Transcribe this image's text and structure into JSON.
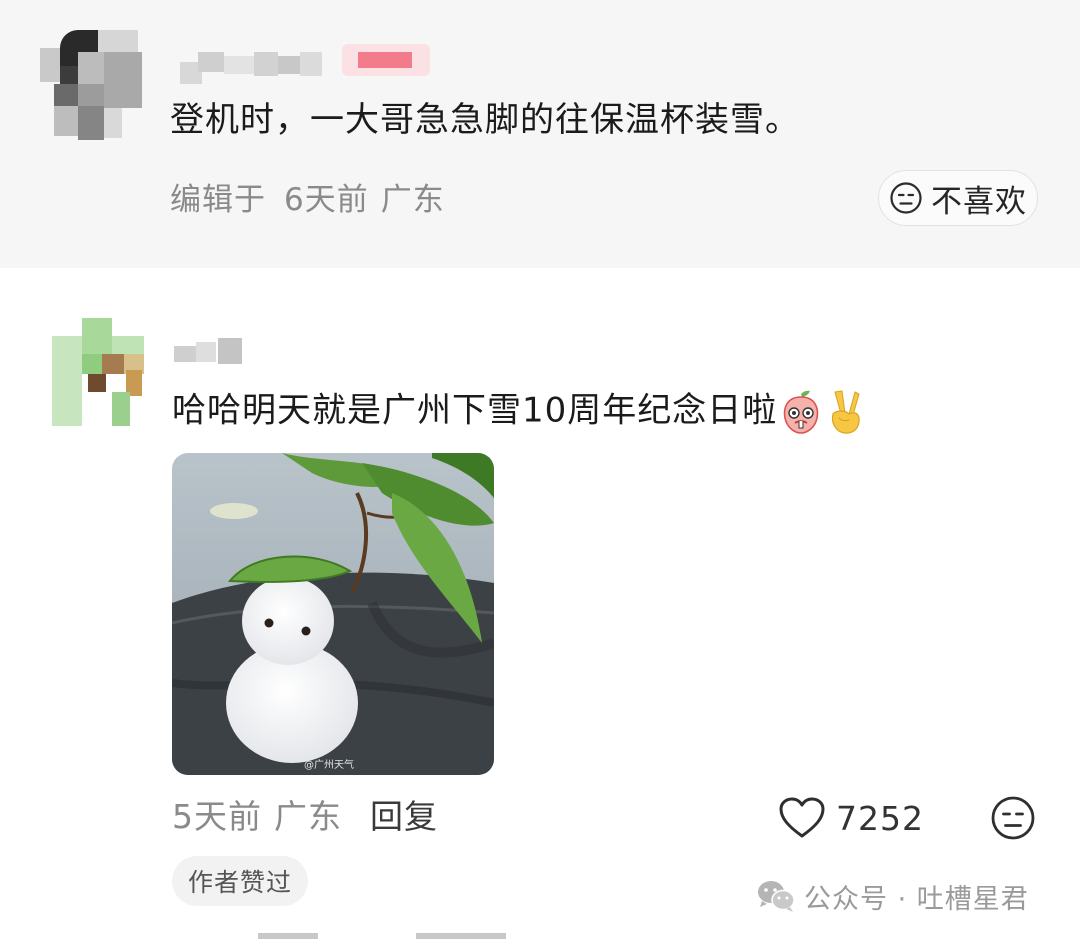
{
  "comment_1": {
    "text": "登机时，一大哥急急脚的往保温杯装雪。",
    "edited_label": "编辑于",
    "time": "6天前",
    "location": "广东",
    "dislike_label": "不喜欢"
  },
  "comment_2": {
    "text": "哈哈明天就是广州下雪10周年纪念日啦",
    "emoji_names": [
      "peach-emoji",
      "victory-hand-emoji"
    ],
    "image_watermark": "@广州天气",
    "time": "5天前",
    "location": "广东",
    "reply_label": "回复",
    "like_count": "7252",
    "author_liked_label": "作者赞过"
  },
  "watermark": {
    "text": "公众号 · 吐槽星君",
    "icon": "wechat-icon"
  },
  "colors": {
    "panel_bg": "#f6f6f6",
    "meta_text": "#8a8a8a",
    "username_blur_pink": "#f06a7c"
  }
}
